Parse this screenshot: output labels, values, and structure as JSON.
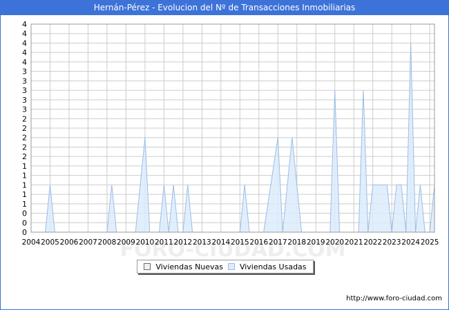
{
  "title": "Hernán-Pérez - Evolucion del Nº de Transacciones Inmobiliarias",
  "footer_url": "http://www.foro-ciudad.com",
  "watermark": "FORO-CIUDAD.COM",
  "colors": {
    "title_bg": "#3d73d8",
    "grid": "#cccccc",
    "used_fill": "#dcebfb",
    "used_stroke": "#9bbce6",
    "new_fill": "#f2f2f2",
    "new_stroke": "#888888"
  },
  "chart_data": {
    "type": "area",
    "title": "Hernán-Pérez - Evolucion del Nº de Transacciones Inmobiliarias",
    "xlabel": "",
    "ylabel": "",
    "xlim": [
      2004,
      2025.25
    ],
    "ylim": [
      0,
      4.4
    ],
    "x_ticks": [
      "2004",
      "2005",
      "2006",
      "2007",
      "2008",
      "2009",
      "2010",
      "2011",
      "2012",
      "2013",
      "2014",
      "2015",
      "2016",
      "2017",
      "2018",
      "2019",
      "2020",
      "2021",
      "2022",
      "2023",
      "2024",
      "2025"
    ],
    "y_tick_values": [
      0,
      0.2,
      0.4,
      0.6,
      0.8,
      1,
      1.2,
      1.4,
      1.6,
      1.8,
      2,
      2.2,
      2.4,
      2.6,
      2.8,
      3,
      3.2,
      3.4,
      3.6,
      3.8,
      4,
      4.2,
      4.4
    ],
    "y_tick_labels": [
      "0",
      "0",
      "0",
      "1",
      "1",
      "1",
      "1",
      "1",
      "2",
      "2",
      "2",
      "2",
      "2",
      "3",
      "3",
      "3",
      "3",
      "3",
      "4",
      "4",
      "4",
      "4",
      "4"
    ],
    "grid": true,
    "legend_position": "bottom-center",
    "series": [
      {
        "name": "Viviendas Nuevas",
        "x": [
          2004,
          2025.25
        ],
        "values": [
          0,
          0
        ]
      },
      {
        "name": "Viviendas Usadas",
        "x": [
          2004,
          2004.75,
          2005,
          2005.25,
          2008,
          2008.25,
          2008.5,
          2009.5,
          2010,
          2010.25,
          2010.75,
          2011,
          2011.25,
          2011.5,
          2011.75,
          2012,
          2012.25,
          2012.5,
          2012.75,
          2015,
          2015.25,
          2015.5,
          2016.25,
          2017,
          2017.25,
          2017.75,
          2018.25,
          2019.75,
          2020,
          2020.25,
          2021.25,
          2021.5,
          2021.75,
          2022,
          2022.75,
          2023,
          2023.25,
          2023.5,
          2023.75,
          2024,
          2024.25,
          2024.5,
          2024.75,
          2025,
          2025.25
        ],
        "values": [
          0,
          0,
          1,
          0,
          0,
          1,
          0,
          0,
          2,
          0,
          0,
          1,
          0,
          1,
          0,
          0,
          1,
          0,
          0,
          0,
          1,
          0,
          0,
          2,
          0,
          2,
          0,
          0,
          3,
          0,
          0,
          3,
          0,
          1,
          1,
          0,
          1,
          1,
          0,
          4,
          0,
          1,
          0,
          0,
          1
        ]
      }
    ]
  }
}
